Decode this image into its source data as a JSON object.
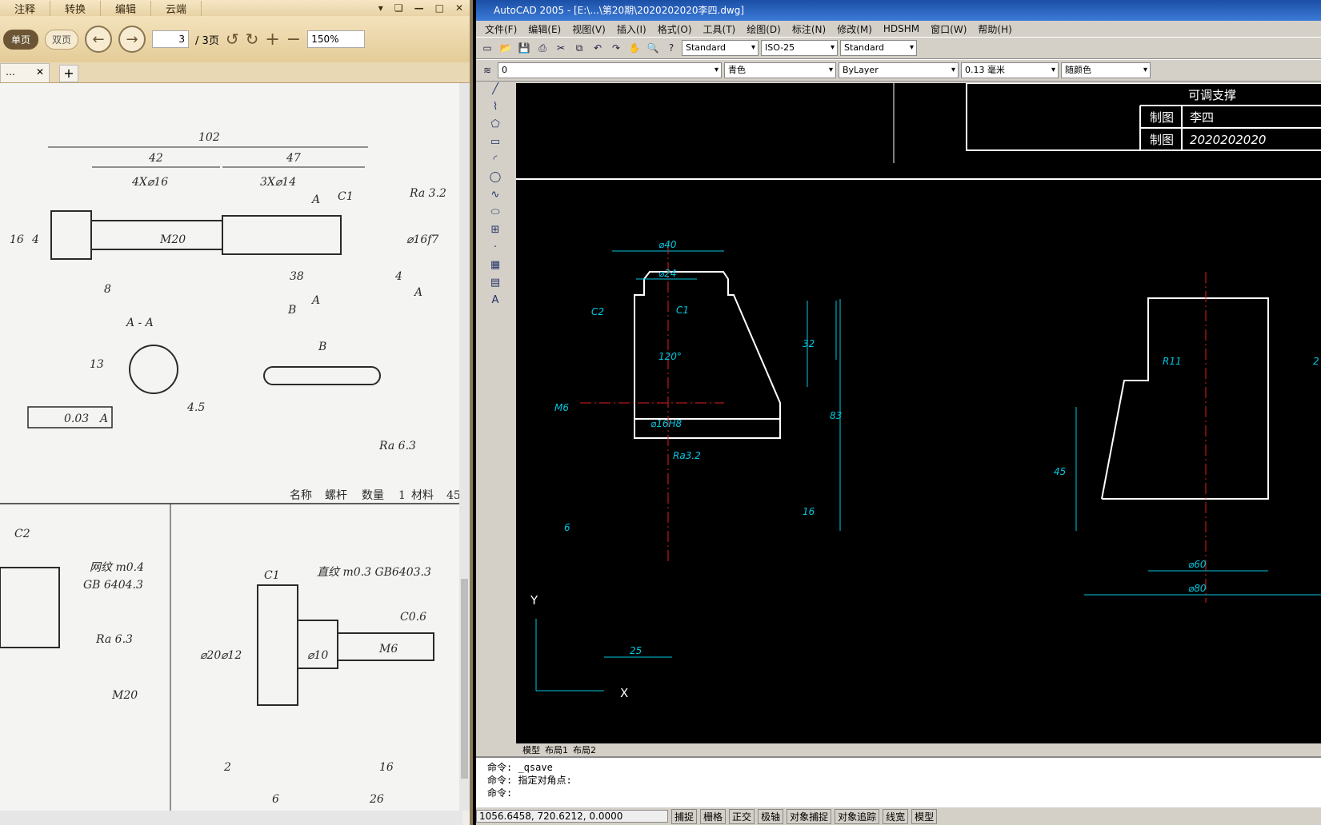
{
  "pdf": {
    "menu": [
      "注释",
      "转换",
      "编辑",
      "云端"
    ],
    "window_controls": [
      "▾",
      "❏",
      "—",
      "□",
      "✕"
    ],
    "view_single": "单页",
    "view_double": "双页",
    "page_current": "3",
    "page_total": "/ 3页",
    "zoom": "150%",
    "tab_close": "✕",
    "tab_add": "+",
    "drawing_texts": [
      "102",
      "42",
      "47",
      "4X⌀16",
      "3X⌀14",
      "A",
      "C1",
      "Ra 3.2",
      "16",
      "4",
      "M20",
      "⌀16f7",
      "8",
      "38",
      "4",
      "A",
      "B",
      "A",
      "A - A",
      "B",
      "13",
      "4.5",
      "0.03",
      "A",
      "Ra 6.3",
      "名称",
      "螺杆",
      "数量",
      "1",
      "材料",
      "45",
      "C2",
      "网纹 m0.4",
      "GB 6404.3",
      "Ra 6.3",
      "M20",
      "C1",
      "直纹 m0.3 GB6403.3",
      "C0.6",
      "⌀20",
      "⌀12",
      "⌀10",
      "M6",
      "2",
      "16",
      "6",
      "26"
    ]
  },
  "cad": {
    "title": "AutoCAD 2005 - [E:\\...\\第20期\\2020202020李四.dwg]",
    "menu": [
      "文件(F)",
      "编辑(E)",
      "视图(V)",
      "插入(I)",
      "格式(O)",
      "工具(T)",
      "绘图(D)",
      "标注(N)",
      "修改(M)",
      "HDSHM",
      "窗口(W)",
      "帮助(H)"
    ],
    "text_style": "Standard",
    "dim_style": "ISO-25",
    "table_style": "Standard",
    "layer": "0",
    "color": "青色",
    "linetype": "ByLayer",
    "lineweight": "0.13 毫米",
    "plotstyle": "随颜色",
    "title_block": {
      "heading": "可调支撑",
      "row1_label": "制图",
      "row1_value": "李四",
      "row2_label": "制图",
      "row2_value": "2020202020"
    },
    "dims": [
      "⌀40",
      "⌀24",
      "C2",
      "C1",
      "120°",
      "32",
      "83",
      "M6",
      "⌀16H8",
      "Ra3.2",
      "16",
      "6",
      "R11",
      "45",
      "⌀60",
      "⌀80",
      "2",
      "25"
    ],
    "ucs": {
      "y": "Y",
      "x": "X"
    },
    "layout_tabs": [
      "模型",
      "布局1",
      "布局2"
    ],
    "commands": [
      "命令: _qsave",
      "命令: 指定对角点:",
      "命令:"
    ],
    "coords": "1056.6458, 720.6212, 0.0000",
    "status": [
      "捕捉",
      "栅格",
      "正交",
      "极轴",
      "对象捕捉",
      "对象追踪",
      "线宽",
      "模型"
    ]
  },
  "colors": {
    "cyan": "#00c8e0",
    "white": "#ffffff",
    "red": "#e02020",
    "ink": "#2a2a2a"
  }
}
